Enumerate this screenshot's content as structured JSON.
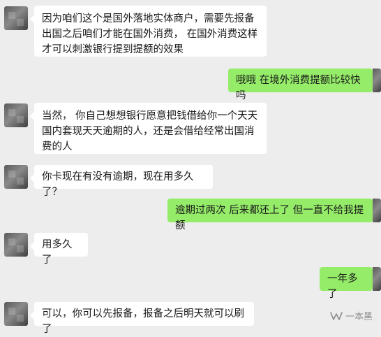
{
  "messages": [
    {
      "side": "left",
      "text": "因为咱们这个是国外落地实体商户，需要先报备出国之后咱们才能在国外消费， 在国外消费这样才可以刺激银行提到提额的效果"
    },
    {
      "side": "right",
      "text": "哦哦 在境外消费提额比较快吗"
    },
    {
      "side": "left",
      "text": "当然， 你自己想想银行愿意把钱借给你一个天天国内套现天天逾期的人，还是会借给经常出国消费的人"
    },
    {
      "side": "left",
      "text": "你卡现在有没有逾期，现在用多久了？"
    },
    {
      "side": "right",
      "text": "逾期过两次 后来都还上了 但一直不给我提额"
    },
    {
      "side": "left",
      "text": "用多久了"
    },
    {
      "side": "right",
      "text": "一年多了"
    },
    {
      "side": "left",
      "text": "可以，你可以先报备，报备之后明天就可以刷了"
    }
  ],
  "watermark": {
    "text": "一本黑",
    "icon": "wechat-channel-icon"
  },
  "colors": {
    "background": "#ededed",
    "left_bubble": "#ffffff",
    "right_bubble": "#95ec69",
    "text": "#191919"
  }
}
